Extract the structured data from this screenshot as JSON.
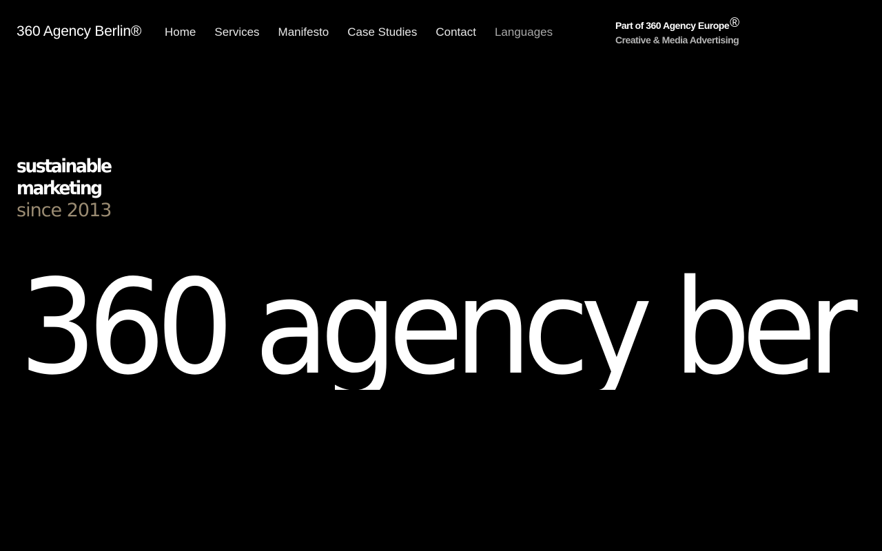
{
  "header": {
    "brand": "360 Agency Berlin®",
    "nav": [
      {
        "label": "Home"
      },
      {
        "label": "Services"
      },
      {
        "label": "Manifesto"
      },
      {
        "label": "Case Studies"
      },
      {
        "label": "Contact"
      },
      {
        "label": "Languages"
      }
    ],
    "group_line1": "Part of 360 Agency Europe",
    "group_reg": "®",
    "group_line2": "Creative & Media Advertising"
  },
  "tagline": {
    "line1": "SUStaInaBle",
    "line2": "MaRketING",
    "line3": "SINCE 2013",
    "line3_color": "#9a8b72"
  },
  "hero": {
    "text": "360 AGENCY BER"
  }
}
